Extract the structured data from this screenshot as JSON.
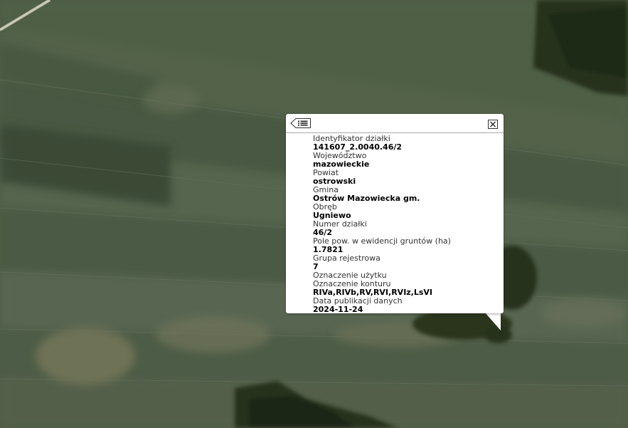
{
  "popup": {
    "attributes": [
      {
        "label": "Identyfikator działki",
        "value": "141607_2.0040.46/2"
      },
      {
        "label": "Województwo",
        "value": "mazowieckie"
      },
      {
        "label": "Powiat",
        "value": "ostrowski"
      },
      {
        "label": "Gmina",
        "value": "Ostrów Mazowiecka gm."
      },
      {
        "label": "Obręb",
        "value": "Ugniewo"
      },
      {
        "label": "Numer działki",
        "value": "46/2"
      },
      {
        "label": "Pole pow. w ewidencji gruntów (ha)",
        "value": "1.7821"
      },
      {
        "label": "Grupa rejestrowa",
        "value": "7"
      },
      {
        "label": "Oznaczenie użytku",
        "value": ""
      },
      {
        "label": "Oznaczenie konturu",
        "value": "RIVa,RIVb,RV,RVI,RVIz,LsVI"
      },
      {
        "label": "Data publikacji danych",
        "value": "2024-11-24"
      }
    ],
    "menu_icon": "list-menu-icon",
    "close_icon": "close-icon"
  },
  "map": {
    "type": "aerial-orthophoto",
    "colors": {
      "field_base": "#4f5d46",
      "forest": "#27321f",
      "light_patch": "#7a7a5c",
      "road": "#b7b7a6"
    }
  }
}
